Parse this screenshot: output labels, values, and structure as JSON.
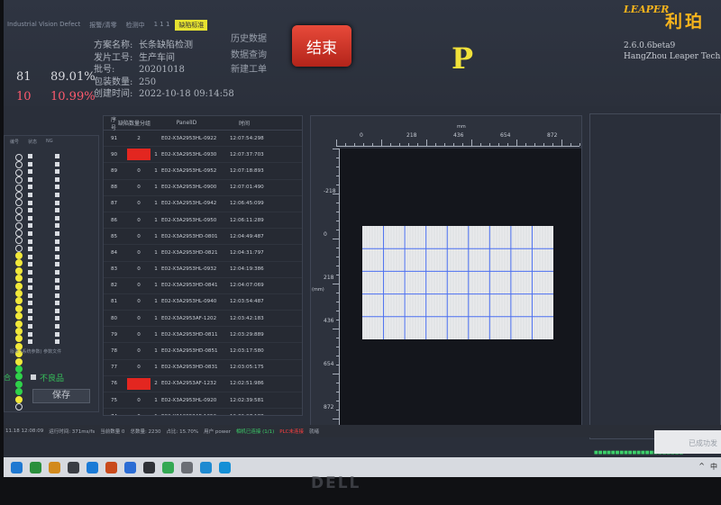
{
  "header": {
    "tabs": [
      {
        "label": "Industrial Vision Defect",
        "active": false
      },
      {
        "label": "报警/清零",
        "active": false
      },
      {
        "label": "检测中",
        "active": false
      },
      {
        "label": "1 1 1",
        "active": false
      },
      {
        "label": "缺陷标准",
        "active": true
      }
    ],
    "stats": {
      "ok_count": "81",
      "ok_pct": "89.01%",
      "ng_count": "10",
      "ng_pct": "10.99%"
    },
    "info": [
      {
        "label": "方案名称:",
        "value": "长条缺陷检测"
      },
      {
        "label": "发片工号:",
        "value": "生产车间"
      },
      {
        "label": "批号:",
        "value": "20201018"
      },
      {
        "label": "包装数量:",
        "value": "250"
      },
      {
        "label": "创建时间:",
        "value": "2022-10-18 09:14:58"
      }
    ],
    "side_buttons": [
      "历史数据",
      "数据查询",
      "新建工单"
    ],
    "end_button": "结束",
    "state_letter": "P"
  },
  "brand": {
    "logo_text": "LEAPER",
    "name": "利珀",
    "version": "2.6.0.6beta9",
    "company": "HangZhou Leaper Tech"
  },
  "left_panel": {
    "headers": [
      "编号",
      "状态",
      "NG"
    ],
    "footer": "版本 (系统参数) 参数文件",
    "led_states": [
      "off",
      "off",
      "off",
      "off",
      "off",
      "off",
      "off",
      "off",
      "off",
      "off",
      "off",
      "off",
      "off",
      "yellow",
      "yellow",
      "yellow",
      "yellow",
      "yellow",
      "yellow",
      "yellow",
      "yellow",
      "yellow",
      "yellow",
      "yellow",
      "yellow",
      "yellow",
      "yellow",
      "yellow",
      "green",
      "green",
      "green",
      "green",
      "yellow",
      "off"
    ],
    "pass_label": "合",
    "checkbox_label": "不良品",
    "save_label": "保存"
  },
  "table": {
    "columns": [
      "序号",
      "缺陷数量",
      "分组",
      "PanelID",
      "时间"
    ],
    "rows": [
      {
        "no": "91",
        "ng": "2",
        "cnt": "",
        "pid": "E02-X3A2953HL-0922",
        "time": "12:07:54:298",
        "red": false
      },
      {
        "no": "90",
        "ng": "",
        "cnt": "1",
        "pid": "E02-X3A2953HL-0930",
        "time": "12:07:37:703",
        "red": true
      },
      {
        "no": "89",
        "ng": "0",
        "cnt": "1",
        "pid": "E02-X3A2953HL-0952",
        "time": "12:07:18:893",
        "red": false
      },
      {
        "no": "88",
        "ng": "0",
        "cnt": "1",
        "pid": "E02-X3A2953HL-0900",
        "time": "12:07:01:490",
        "red": false
      },
      {
        "no": "87",
        "ng": "0",
        "cnt": "1",
        "pid": "E02-X3A2953HL-0942",
        "time": "12:06:45:099",
        "red": false
      },
      {
        "no": "86",
        "ng": "0",
        "cnt": "1",
        "pid": "E02-X3A2953HL-0950",
        "time": "12:06:11:289",
        "red": false
      },
      {
        "no": "85",
        "ng": "0",
        "cnt": "1",
        "pid": "E02-X3A2953HD-0801",
        "time": "12:04:49:487",
        "red": false
      },
      {
        "no": "84",
        "ng": "0",
        "cnt": "1",
        "pid": "E02-X3A2953HD-0821",
        "time": "12:04:31:797",
        "red": false
      },
      {
        "no": "83",
        "ng": "0",
        "cnt": "1",
        "pid": "E02-X3A2953HL-0932",
        "time": "12:04:19:386",
        "red": false
      },
      {
        "no": "82",
        "ng": "0",
        "cnt": "1",
        "pid": "E02-X3A2953HD-0841",
        "time": "12:04:07:069",
        "red": false
      },
      {
        "no": "81",
        "ng": "0",
        "cnt": "1",
        "pid": "E02-X3A2953HL-0940",
        "time": "12:03:54:487",
        "red": false
      },
      {
        "no": "80",
        "ng": "0",
        "cnt": "1",
        "pid": "E02-X3A2953AF-1202",
        "time": "12:03:42:183",
        "red": false
      },
      {
        "no": "79",
        "ng": "0",
        "cnt": "1",
        "pid": "E02-X3A2953HD-0811",
        "time": "12:03:29:889",
        "red": false
      },
      {
        "no": "78",
        "ng": "0",
        "cnt": "1",
        "pid": "E02-X3A2953HD-0851",
        "time": "12:03:17:580",
        "red": false
      },
      {
        "no": "77",
        "ng": "0",
        "cnt": "1",
        "pid": "E02-X3A2953HD-0831",
        "time": "12:03:05:175",
        "red": false
      },
      {
        "no": "76",
        "ng": "",
        "cnt": "2",
        "pid": "E02-X3A2953AF-1232",
        "time": "12:02:51:986",
        "red": true
      },
      {
        "no": "75",
        "ng": "0",
        "cnt": "1",
        "pid": "E02-X3A2953HL-0920",
        "time": "12:02:39:581",
        "red": false
      },
      {
        "no": "74",
        "ng": "0",
        "cnt": "1",
        "pid": "E02-X3A2953AF-1252",
        "time": "12:02:27:188",
        "red": false
      },
      {
        "no": "73",
        "ng": "0",
        "cnt": "1",
        "pid": "E02-X3A2953AF-1212",
        "time": "12:02:14:880",
        "red": false
      },
      {
        "no": "72",
        "ng": "0",
        "cnt": "1",
        "pid": "E02-X3A2953AF-1210",
        "time": "12:02:02:584",
        "red": false
      },
      {
        "no": "71",
        "ng": "0",
        "cnt": "1",
        "pid": "E02-X3A2953MD-2112",
        "time": "12:01:50:287",
        "red": false
      },
      {
        "no": "70",
        "ng": "0",
        "cnt": "1",
        "pid": "E02-X3A2953MD-2132",
        "time": "12:01:37:883",
        "red": false
      }
    ]
  },
  "viewer": {
    "x_ticks": [
      "0",
      "218",
      "436",
      "654",
      "872"
    ],
    "y_ticks": [
      "-218",
      "0",
      "218",
      "436",
      "654",
      "872"
    ],
    "unit_top": "mm",
    "unit_left": "(mm)",
    "grid_cols": 9,
    "grid_rows": 5
  },
  "statusbar": {
    "items": [
      {
        "text": "11.18 12:08:09",
        "tone": "normal"
      },
      {
        "text": "运行时间: 371ms/fs",
        "tone": "normal"
      },
      {
        "text": "当前数量 0",
        "tone": "normal"
      },
      {
        "text": "总数量: 2230",
        "tone": "normal"
      },
      {
        "text": "占比: 15.70%",
        "tone": "normal"
      },
      {
        "text": "用户 power",
        "tone": "normal"
      },
      {
        "text": "相机已连接 (1/1)",
        "tone": "green"
      },
      {
        "text": "PLC未连接",
        "tone": "red"
      },
      {
        "text": "就绪",
        "tone": "normal"
      }
    ]
  },
  "toast": "已成功发",
  "tray": {
    "caret": "^",
    "input": "中"
  },
  "green_footer": "■■■■■■■■■■■■■■■■■■■■■",
  "taskbar_icons": [
    "#1f78d1",
    "#2a8f3c",
    "#d28a1e",
    "#3a3d44",
    "#1a7ad6",
    "#c94a1c",
    "#2b6cd4",
    "#2f3137",
    "#34a853",
    "#6b6e75",
    "#1f8ad1",
    "#148fd6"
  ],
  "colors": {
    "accent_red": "#e32620",
    "led_yellow": "#f1e83a",
    "led_green": "#2fd14a",
    "state_yellow": "#f1e13a",
    "grid_blue": "#4b6ff0"
  }
}
